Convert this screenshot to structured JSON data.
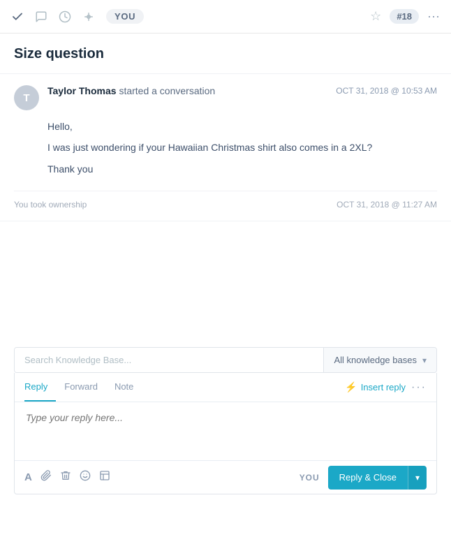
{
  "toolbar": {
    "check_icon": "✓",
    "chat_icon": "💬",
    "clock_icon": "⏱",
    "filter_icon": "⚡",
    "you_label": "YOU",
    "ticket_number": "#18",
    "star_icon": "☆",
    "more_icon": "···"
  },
  "page": {
    "title": "Size question"
  },
  "conversation": {
    "sender": "Taylor Thomas",
    "action": "started a conversation",
    "timestamp": "OCT 31, 2018 @ 10:53 AM",
    "avatar_letter": "T",
    "body_line1": "Hello,",
    "body_line2": "I was just wondering if your Hawaiian Christmas shirt also comes in a 2XL?",
    "body_line3": "Thank you",
    "ownership_text": "You took ownership",
    "ownership_timestamp": "OCT 31, 2018 @ 11:27 AM"
  },
  "knowledge_base": {
    "search_placeholder": "Search Knowledge Base...",
    "dropdown_label": "All knowledge bases",
    "dropdown_arrow": "▾"
  },
  "reply_area": {
    "tab_reply": "Reply",
    "tab_forward": "Forward",
    "tab_note": "Note",
    "insert_reply_label": "Insert reply",
    "more_dots": "···",
    "textarea_placeholder": "Type your reply here...",
    "you_label": "YOU",
    "reply_close_label": "Reply & Close",
    "dropdown_arrow": "▾"
  },
  "footer_icons": {
    "text_icon": "A",
    "attach_icon": "📎",
    "delete_icon": "🗑",
    "emoji_icon": "☺",
    "article_icon": "📋"
  }
}
